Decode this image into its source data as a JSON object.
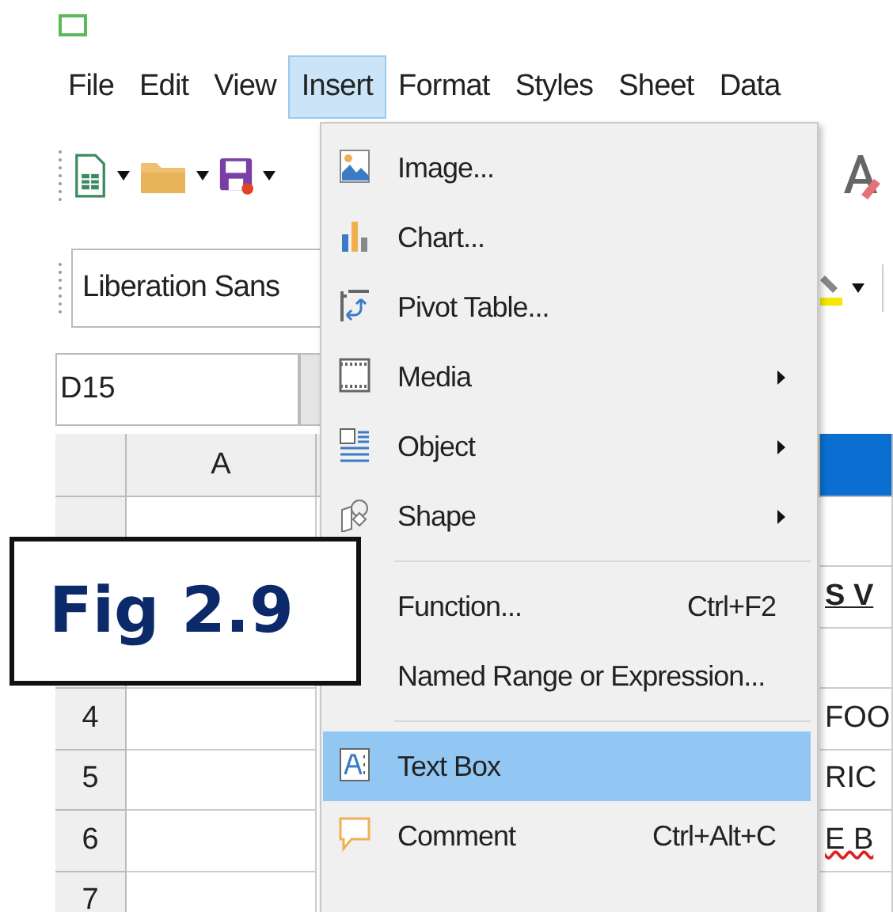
{
  "menu_bar": [
    {
      "label": "File",
      "selected": false
    },
    {
      "label": "Edit",
      "selected": false
    },
    {
      "label": "View",
      "selected": false
    },
    {
      "label": "Insert",
      "selected": true
    },
    {
      "label": "Format",
      "selected": false
    },
    {
      "label": "Styles",
      "selected": false
    },
    {
      "label": "Sheet",
      "selected": false
    },
    {
      "label": "Data",
      "selected": false
    }
  ],
  "font_name": "Liberation Sans",
  "name_box": "D15",
  "columns": [
    {
      "label": "A",
      "selected": false
    },
    {
      "selected": true
    }
  ],
  "rows": [
    {},
    {
      "cell": "S V",
      "bold": true
    },
    {},
    {
      "header": "4",
      "cell": "FOO"
    },
    {
      "header": "5",
      "cell": "RIC"
    },
    {
      "header": "6",
      "cell": "E B",
      "spelling_error": true
    },
    {
      "header": "7"
    }
  ],
  "insert_menu": [
    {
      "kind": "image",
      "label": "Image...",
      "submenu": false,
      "selected": false
    },
    {
      "kind": "chart",
      "label": "Chart...",
      "submenu": false,
      "selected": false
    },
    {
      "kind": "pivot",
      "label": "Pivot Table...",
      "submenu": false,
      "selected": false
    },
    {
      "kind": "media",
      "label": "Media",
      "submenu": true,
      "selected": false
    },
    {
      "kind": "object",
      "label": "Object",
      "submenu": true,
      "selected": false
    },
    {
      "kind": "shape",
      "label": "Shape",
      "submenu": true,
      "selected": false
    },
    {
      "kind": "separator"
    },
    {
      "kind": "plain",
      "label": "Function...",
      "shortcut": "Ctrl+F2",
      "submenu": false,
      "selected": false
    },
    {
      "kind": "plain",
      "label": "Named Range or Expression...",
      "submenu": false,
      "selected": false
    },
    {
      "kind": "separator"
    },
    {
      "kind": "textbox",
      "label": "Text Box",
      "submenu": false,
      "selected": true
    },
    {
      "kind": "comment",
      "label": "Comment",
      "shortcut": "Ctrl+Alt+C",
      "submenu": false,
      "selected": false
    }
  ],
  "figure_label": "Fig 2.9"
}
